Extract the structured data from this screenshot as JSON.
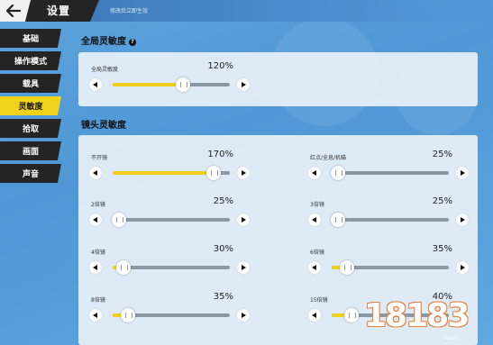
{
  "header": {
    "title": "设置",
    "subtitle": "修改后立即生效"
  },
  "sidebar": {
    "items": [
      {
        "label": "基础",
        "active": false
      },
      {
        "label": "操作模式",
        "active": false
      },
      {
        "label": "载具",
        "active": false
      },
      {
        "label": "灵敏度",
        "active": true
      },
      {
        "label": "拾取",
        "active": false
      },
      {
        "label": "画面",
        "active": false
      },
      {
        "label": "声音",
        "active": false
      }
    ]
  },
  "global_section": {
    "title": "全局灵敏度",
    "help_icon": "question-icon",
    "setting": {
      "label": "全局灵敏度",
      "value": "120%",
      "level": 0.6
    }
  },
  "scope_section": {
    "title": "镜头灵敏度",
    "settings": [
      {
        "label": "不开镜",
        "value": "170%",
        "level": 0.86
      },
      {
        "label": "红点/全息/机瞄",
        "value": "25%",
        "level": 0.05
      },
      {
        "label": "2倍镜",
        "value": "25%",
        "level": 0.05
      },
      {
        "label": "3倍镜",
        "value": "25%",
        "level": 0.05
      },
      {
        "label": "4倍镜",
        "value": "30%",
        "level": 0.09
      },
      {
        "label": "6倍镜",
        "value": "35%",
        "level": 0.13
      },
      {
        "label": "8倍镜",
        "value": "35%",
        "level": 0.13
      },
      {
        "label": "15倍镜",
        "value": "40%",
        "level": 0.17
      }
    ]
  },
  "watermark": {
    "text": "18183",
    "sub": ".com"
  },
  "colors": {
    "accent": "#f2cf1a",
    "dark": "#242424",
    "background": "#5da4dd",
    "track": "#8b98a6"
  }
}
